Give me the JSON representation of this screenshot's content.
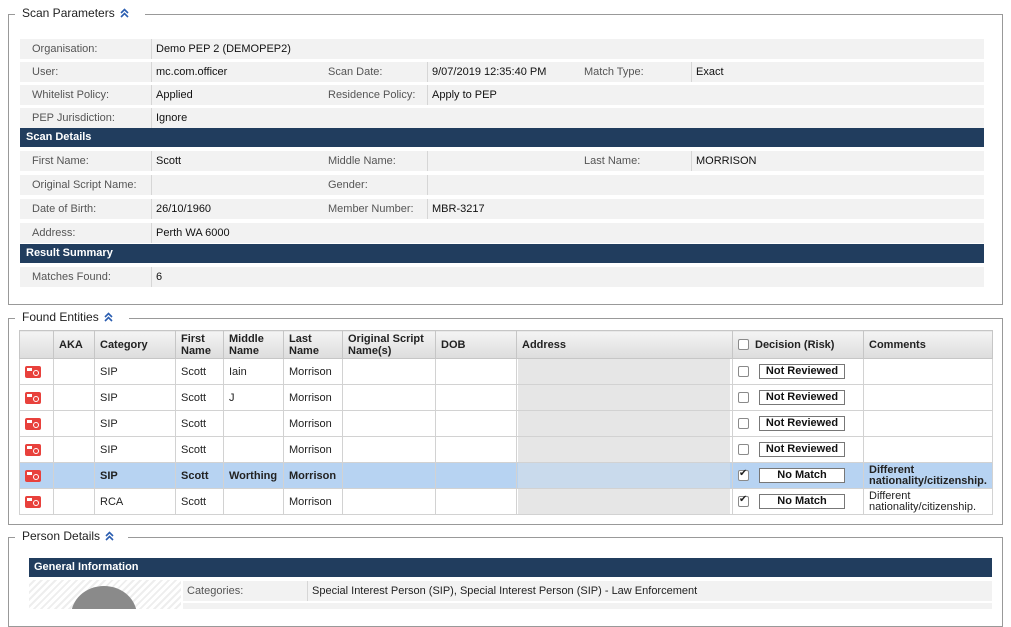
{
  "scan_parameters": {
    "legend": "Scan Parameters",
    "organisation_label": "Organisation:",
    "organisation": "Demo PEP 2 (DEMOPEP2)",
    "user_label": "User:",
    "user": "mc.com.officer",
    "scan_date_label": "Scan Date:",
    "scan_date": "9/07/2019 12:35:40 PM",
    "match_type_label": "Match Type:",
    "match_type": "Exact",
    "whitelist_label": "Whitelist Policy:",
    "whitelist": "Applied",
    "residence_label": "Residence Policy:",
    "residence": "Apply to PEP",
    "pep_jurisdiction_label": "PEP Jurisdiction:",
    "pep_jurisdiction": "Ignore"
  },
  "scan_details": {
    "title": "Scan Details",
    "first_name_label": "First Name:",
    "first_name": "Scott",
    "middle_name_label": "Middle Name:",
    "middle_name": "",
    "last_name_label": "Last Name:",
    "last_name": "MORRISON",
    "original_script_label": "Original Script Name:",
    "original_script": "",
    "gender_label": "Gender:",
    "gender": "",
    "dob_label": "Date of Birth:",
    "dob": "26/10/1960",
    "member_number_label": "Member Number:",
    "member_number": "MBR-3217",
    "address_label": "Address:",
    "address": "Perth WA 6000"
  },
  "result_summary": {
    "title": "Result Summary",
    "matches_label": "Matches Found:",
    "matches": "6"
  },
  "found_entities": {
    "legend": "Found Entities",
    "headers": {
      "aka": "AKA",
      "category": "Category",
      "first_name": "First Name",
      "middle_name": "Middle Name",
      "last_name": "Last Name",
      "original_script": "Original Script Name(s)",
      "dob": "DOB",
      "address": "Address",
      "decision": "Decision (Risk)",
      "comments": "Comments"
    },
    "rows": [
      {
        "category": "SIP",
        "first": "Scott",
        "middle": "Iain",
        "last": "Morrison",
        "decision": "Not Reviewed",
        "checked": false,
        "comment": ""
      },
      {
        "category": "SIP",
        "first": "Scott",
        "middle": "J",
        "last": "Morrison",
        "decision": "Not Reviewed",
        "checked": false,
        "comment": ""
      },
      {
        "category": "SIP",
        "first": "Scott",
        "middle": "",
        "last": "Morrison",
        "decision": "Not Reviewed",
        "checked": false,
        "comment": ""
      },
      {
        "category": "SIP",
        "first": "Scott",
        "middle": "",
        "last": "Morrison",
        "decision": "Not Reviewed",
        "checked": false,
        "comment": ""
      },
      {
        "category": "SIP",
        "first": "Scott",
        "middle": "Worthing",
        "last": "Morrison",
        "decision": "No Match",
        "checked": true,
        "comment": "Different nationality/citizenship.",
        "selected": true
      },
      {
        "category": "RCA",
        "first": "Scott",
        "middle": "",
        "last": "Morrison",
        "decision": "No Match",
        "checked": true,
        "comment": "Different nationality/citizenship."
      }
    ]
  },
  "person_details": {
    "legend": "Person Details",
    "general_title": "General Information",
    "categories_label": "Categories:",
    "categories": "Special Interest Person (SIP), Special Interest Person (SIP) - Law Enforcement"
  },
  "colors": {
    "section_bar": "#213d5e",
    "selected_row": "#b7d3f2",
    "flag": "#e8413c"
  }
}
